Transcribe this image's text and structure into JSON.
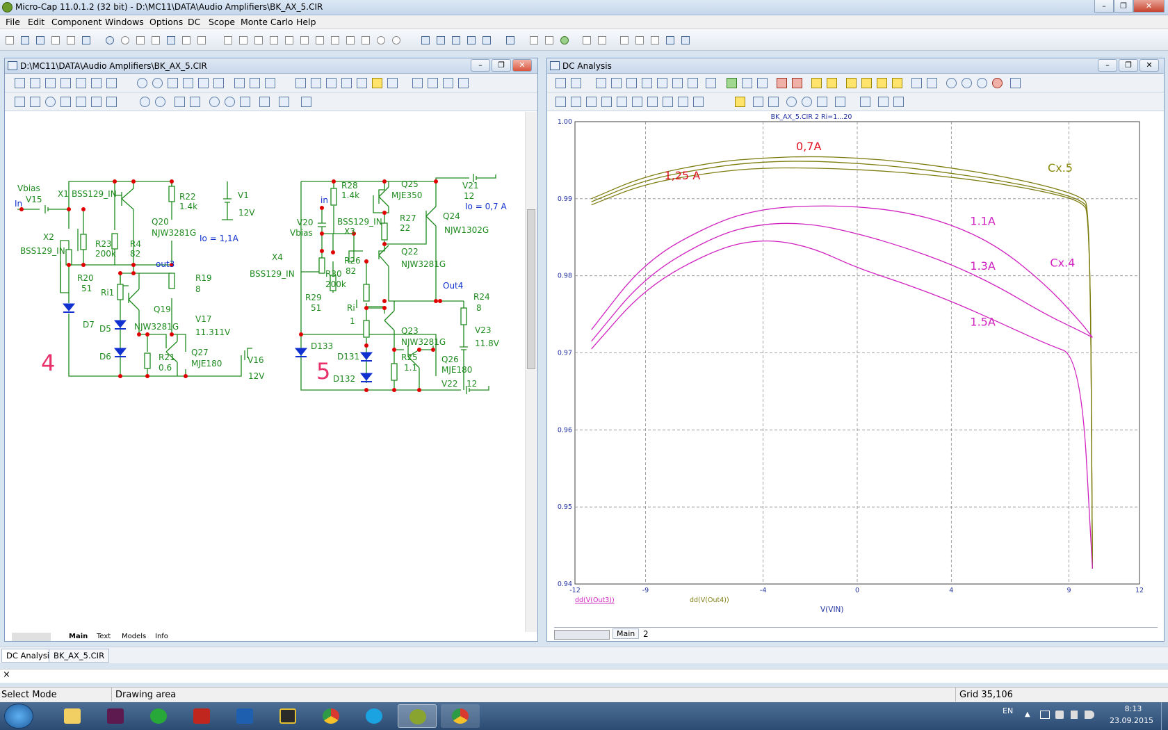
{
  "app": {
    "title": "Micro-Cap 11.0.1.2 (32 bit) - D:\\MC11\\DATA\\Audio Amplifiers\\BK_AX_5.CIR"
  },
  "menu": [
    "File",
    "Edit",
    "Component",
    "Windows",
    "Options",
    "DC",
    "Scope",
    "Monte Carlo",
    "Help"
  ],
  "schematic": {
    "title": "D:\\MC11\\DATA\\Audio Amplifiers\\BK_AX_5.CIR",
    "tabs": [
      "Main",
      "Text",
      "Models",
      "Info"
    ],
    "labels1": {
      "vbias": "Vbias",
      "in": "In",
      "v15": "V15",
      "x1": "X1",
      "bss_a": "BSS129_IN",
      "x2": "X2",
      "bss_b": "BSS129_IN",
      "r22": "R22",
      "r22v": "1.4k",
      "v1": "V1",
      "v1v": "12V",
      "q20": "Q20",
      "q20m": "NJW3281G",
      "io": "Io = 1,1A",
      "r23": "R23",
      "r23v": "200k",
      "r4": "R4",
      "r4v": "82",
      "r20": "R20",
      "r20v": "51",
      "out3": "out3",
      "r19": "R19",
      "r19v": "8",
      "ri1": "Ri1",
      "q19": "Q19",
      "q19m": "NJW3281G",
      "d7": "D7",
      "d5": "D5",
      "d6": "D6",
      "v17": "V17",
      "v17v": "11.311V",
      "q27": "Q27",
      "q27m": "MJE180",
      "r21": "R21",
      "r21v": "0.6",
      "v16": "V16",
      "v16v": "12V",
      "num": "4"
    },
    "labels2": {
      "r28": "R28",
      "r28v": "1.4k",
      "q25": "Q25",
      "q25m": "MJE350",
      "v21": "V21",
      "v21v": "12",
      "io": "Io = 0,7 A",
      "in": "in",
      "v20": "V20",
      "vbias": "Vbias",
      "bss_a": "BSS129_IN",
      "x3": "X3",
      "r27": "R27",
      "r27v": "22",
      "q24": "Q24",
      "q24m": "NJW1302G",
      "x4": "X4",
      "q22": "Q22",
      "r26": "R26",
      "r26v": "82",
      "q22m": "NJW3281G",
      "bss_b": "BSS129_IN",
      "r30": "R30",
      "r30v": "200k",
      "out4": "Out4",
      "r29": "R29",
      "r29v": "51",
      "r24": "R24",
      "r24v": "8",
      "ri": "Ri",
      "riv": "1",
      "q23": "Q23",
      "q23m": "NJW3281G",
      "v23": "V23",
      "v23v": "11.8V",
      "d133": "D133",
      "d131": "D131",
      "r25": "R25",
      "r25v": "1.1",
      "q26": "Q26",
      "q26m": "MJE180",
      "d132": "D132",
      "v22": "V22",
      "v22v": "12",
      "num": "5"
    }
  },
  "analysis": {
    "title": "DC Analysis",
    "tabs": [
      "Main",
      "2"
    ]
  },
  "chart_data": {
    "type": "line",
    "title": "BK_AX_5.CIR 2 Ri=1...20",
    "xlabel": "V(VIN)",
    "xlim": [
      -12,
      12
    ],
    "ylim": [
      0.94,
      1.0
    ],
    "xticks": [
      "-12",
      "-9",
      "-4",
      "0",
      "4",
      "9",
      "12"
    ],
    "yticks": [
      "1.00",
      "0.99",
      "0.98",
      "0.97",
      "0.96",
      "0.95",
      "0.94"
    ],
    "grid": true,
    "legend": [
      "dd(V(Out3))",
      "dd(V(Out4))"
    ],
    "annotations": [
      {
        "text": "0,7A",
        "x": -2.6,
        "y": 0.9963,
        "color": "#e01020"
      },
      {
        "text": "1,25 A",
        "x": -8.2,
        "y": 0.9925,
        "color": "#e01020"
      },
      {
        "text": "Cx.5",
        "x": 8.1,
        "y": 0.9935,
        "color": "#8a8a10"
      },
      {
        "text": "1.1A",
        "x": 4.8,
        "y": 0.9866,
        "color": "#d020c0"
      },
      {
        "text": "Cx.4",
        "x": 8.2,
        "y": 0.9812,
        "color": "#d020c0"
      },
      {
        "text": "1.3A",
        "x": 4.8,
        "y": 0.9808,
        "color": "#d020c0"
      },
      {
        "text": "1.5A",
        "x": 4.8,
        "y": 0.9735,
        "color": "#d020c0"
      }
    ],
    "series": [
      {
        "name": "dd(V(Out4))",
        "color": "#7d7d10",
        "x": [
          -11.3,
          -9,
          -6,
          -4,
          -2,
          0,
          2,
          4,
          6,
          8,
          9.5,
          9.9,
          10.0
        ],
        "y": [
          0.9896,
          0.9925,
          0.9942,
          0.9948,
          0.9949,
          0.9946,
          0.9941,
          0.9933,
          0.9924,
          0.9912,
          0.9899,
          0.9885,
          0.942
        ]
      },
      {
        "name": "dd(V(Out4))",
        "color": "#7d7d10",
        "x": [
          -11.3,
          -9,
          -6,
          -4,
          -2,
          0,
          2,
          4,
          6,
          8,
          9.5,
          9.9,
          10.0
        ],
        "y": [
          0.99,
          0.993,
          0.9948,
          0.9953,
          0.9955,
          0.9953,
          0.9948,
          0.994,
          0.993,
          0.9917,
          0.9903,
          0.989,
          0.942
        ]
      },
      {
        "name": "dd(V(Out4))",
        "color": "#7d7d10",
        "x": [
          -11.3,
          -9,
          -6,
          -4,
          -2,
          0,
          2,
          4,
          6,
          8,
          9.5,
          9.9,
          10.0
        ],
        "y": [
          0.9892,
          0.992,
          0.9935,
          0.994,
          0.994,
          0.9938,
          0.9934,
          0.9928,
          0.992,
          0.9909,
          0.9897,
          0.988,
          0.942
        ]
      },
      {
        "name": "dd(V(Out3))",
        "color": "#d020c0",
        "x": [
          -11.3,
          -9,
          -6,
          -4,
          -2,
          0,
          2,
          4,
          6,
          8,
          9.5,
          10.0
        ],
        "y": [
          0.973,
          0.982,
          0.987,
          0.9887,
          0.9891,
          0.989,
          0.9883,
          0.9867,
          0.9838,
          0.9789,
          0.974,
          0.972
        ]
      },
      {
        "name": "dd(V(Out3))",
        "color": "#d020c0",
        "x": [
          -11.3,
          -9,
          -6,
          -4,
          -2,
          0,
          2,
          4,
          6,
          8,
          9.5,
          10.0
        ],
        "y": [
          0.9715,
          0.98,
          0.9853,
          0.9868,
          0.9868,
          0.9855,
          0.9837,
          0.9815,
          0.9786,
          0.975,
          0.9728,
          0.972
        ]
      },
      {
        "name": "dd(V(Out3))",
        "color": "#d020c0",
        "x": [
          -11.3,
          -9,
          -6,
          -4,
          -2,
          0,
          2,
          4,
          6,
          8,
          9.5,
          10.0
        ],
        "y": [
          0.9705,
          0.9785,
          0.9835,
          0.9848,
          0.9838,
          0.981,
          0.979,
          0.9767,
          0.974,
          0.9712,
          0.9695,
          0.942
        ]
      }
    ]
  },
  "bottom_tabs": [
    "DC Analysis",
    "BK_AX_5.CIR"
  ],
  "status": {
    "mode": "Select Mode",
    "area": "Drawing area",
    "grid": "Grid 35,106"
  },
  "tray": {
    "lang": "EN",
    "time": "8:13",
    "date": "23.09.2015"
  },
  "colors": {
    "schematic": "#1d8a1d",
    "node": "#e00000",
    "diode": "#1030d0",
    "curve_olive": "#7d7d10",
    "curve_magenta": "#d020c0"
  }
}
